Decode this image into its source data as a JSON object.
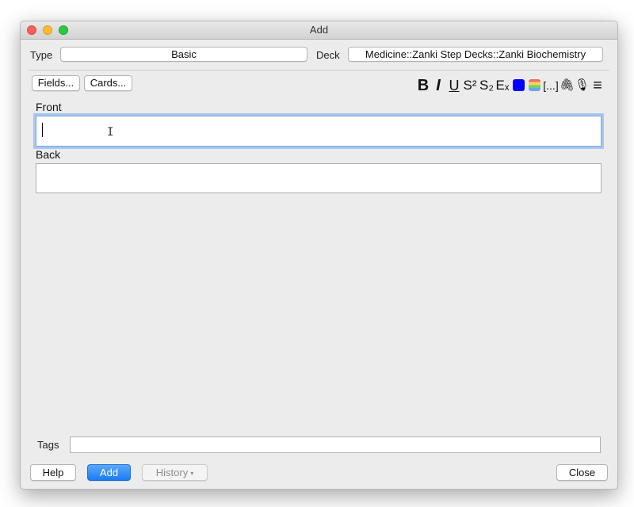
{
  "window": {
    "title": "Add"
  },
  "type_row": {
    "type_label": "Type",
    "type_value": "Basic",
    "deck_label": "Deck",
    "deck_value": "Medicine::Zanki Step Decks::Zanki Biochemistry"
  },
  "buttons": {
    "fields": "Fields...",
    "cards": "Cards..."
  },
  "toolbar": {
    "bold": "B",
    "italic": "I",
    "underline": "U",
    "superscript": "S²",
    "subscript": "S₂",
    "clear_format": "Eₓ",
    "cloze": "[...]",
    "attach": "🖇",
    "record": "🎙",
    "more": "≡",
    "colors": {
      "text_color": "#0000ff"
    }
  },
  "fields": [
    {
      "label": "Front",
      "value": ""
    },
    {
      "label": "Back",
      "value": ""
    }
  ],
  "tags": {
    "label": "Tags",
    "value": ""
  },
  "footer": {
    "help": "Help",
    "add": "Add",
    "history": "History",
    "history_caret": "▾",
    "close": "Close"
  }
}
